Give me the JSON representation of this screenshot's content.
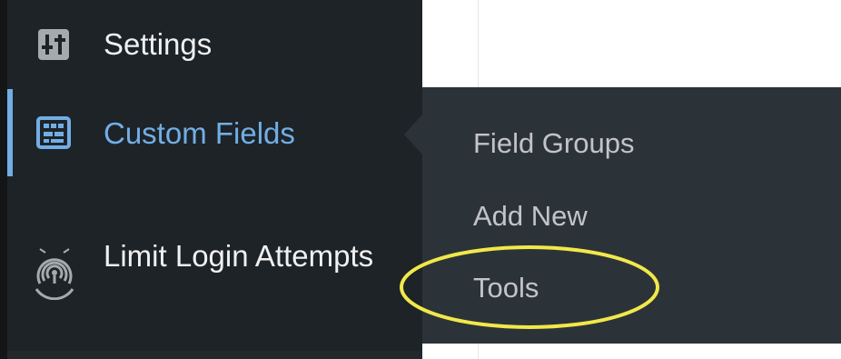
{
  "sidebar": {
    "items": [
      {
        "label": "Settings",
        "icon": "settings-icon"
      },
      {
        "label": "Custom Fields",
        "icon": "custom-fields-icon",
        "active": true
      },
      {
        "label": "Limit Login Attempts",
        "icon": "limit-login-icon"
      }
    ]
  },
  "flyout": {
    "items": [
      {
        "label": "Field Groups"
      },
      {
        "label": "Add New"
      },
      {
        "label": "Tools",
        "highlighted": true
      }
    ]
  },
  "colors": {
    "sidebar_bg": "#1d2327",
    "flyout_bg": "#2c3338",
    "active_accent": "#72aee6",
    "text": "#f0f0f1",
    "submenu_text": "#c3c4c7",
    "highlight": "#f2e84a"
  }
}
